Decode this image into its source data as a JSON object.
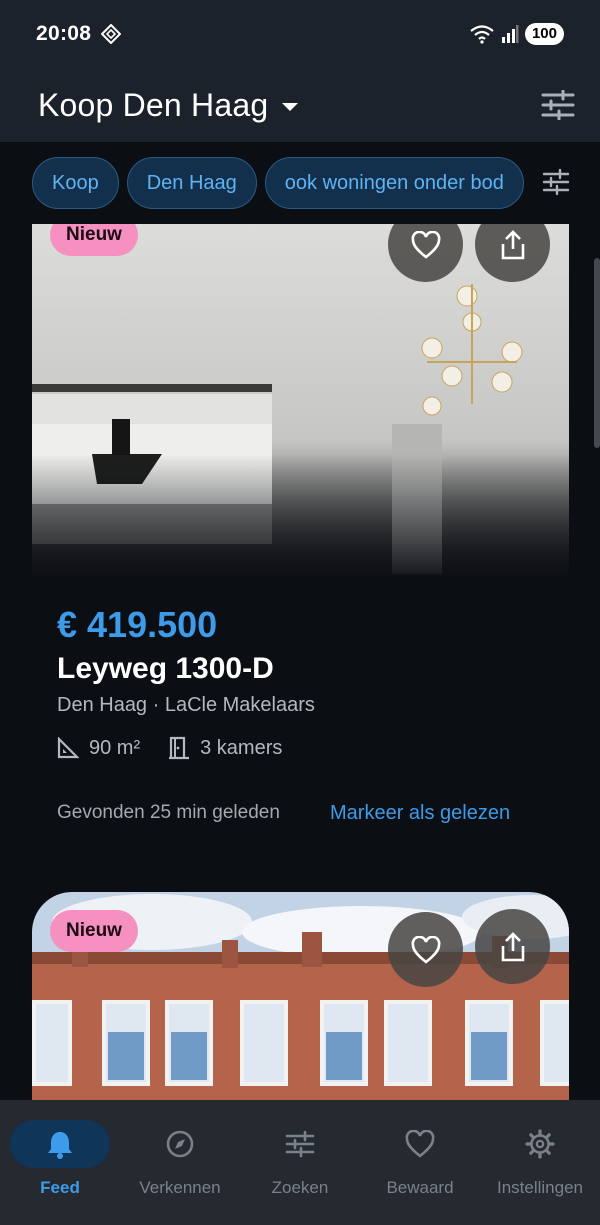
{
  "status": {
    "time": "20:08",
    "battery": "100"
  },
  "app_bar": {
    "title": "Koop Den Haag"
  },
  "chips": [
    "Koop",
    "Den Haag",
    "ook woningen onder bod"
  ],
  "listing1": {
    "badge": "Nieuw",
    "price": "€ 419.500",
    "address": "Leyweg 1300-D",
    "subline": "Den Haag · LaCle Makelaars",
    "area": "90 m²",
    "rooms": "3 kamers",
    "found": "Gevonden 25 min geleden",
    "mark_read": "Markeer als gelezen"
  },
  "listing2": {
    "badge": "Nieuw"
  },
  "nav": [
    {
      "label": "Feed",
      "icon": "bell-icon",
      "active": true
    },
    {
      "label": "Verkennen",
      "icon": "explore-icon"
    },
    {
      "label": "Zoeken",
      "icon": "tune-icon"
    },
    {
      "label": "Bewaard",
      "icon": "heart-icon"
    },
    {
      "label": "Instellingen",
      "icon": "gear-icon"
    }
  ],
  "colors": {
    "accent": "#3d9be9",
    "badge": "#f590c0",
    "chip_bg": "#12304c",
    "background": "#0b0e13",
    "appbar": "#1c222b"
  }
}
